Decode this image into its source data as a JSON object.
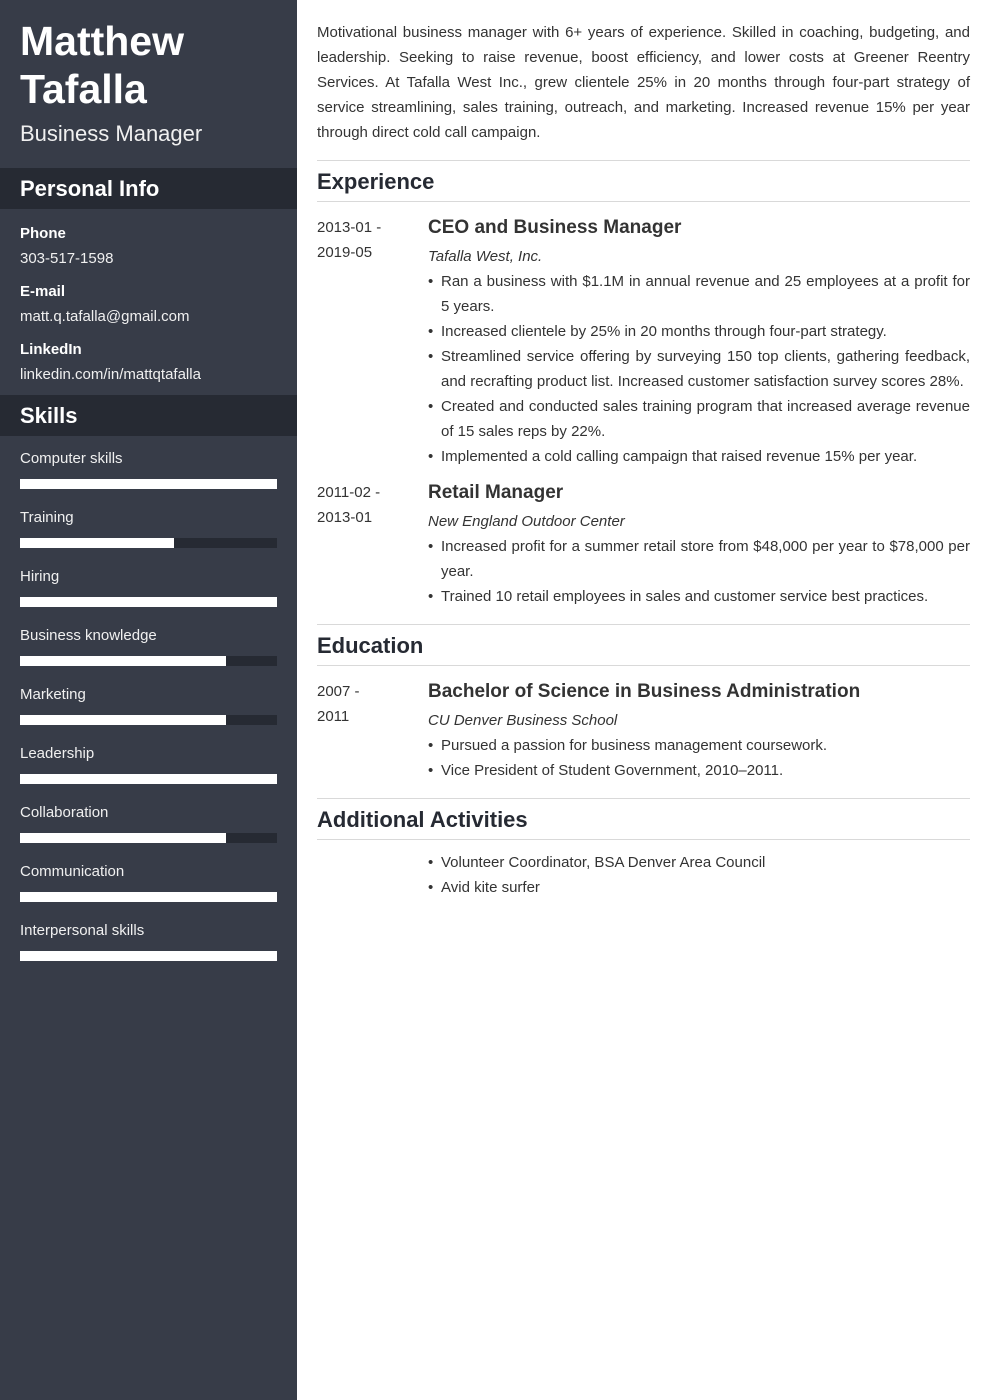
{
  "profile": {
    "first_name": "Matthew",
    "last_name": "Tafalla",
    "role": "Business Manager"
  },
  "personal_info": {
    "title": "Personal Info",
    "items": [
      {
        "label": "Phone",
        "value": "303-517-1598"
      },
      {
        "label": "E-mail",
        "value": "matt.q.tafalla@gmail.com"
      },
      {
        "label": "LinkedIn",
        "value": "linkedin.com/in/mattqtafalla"
      }
    ]
  },
  "skills": {
    "title": "Skills",
    "items": [
      {
        "label": "Computer skills",
        "level": 1.0
      },
      {
        "label": "Training",
        "level": 0.6
      },
      {
        "label": "Hiring",
        "level": 1.0
      },
      {
        "label": "Business knowledge",
        "level": 0.8
      },
      {
        "label": "Marketing",
        "level": 0.8
      },
      {
        "label": "Leadership",
        "level": 1.0
      },
      {
        "label": "Collaboration",
        "level": 0.8
      },
      {
        "label": "Communication",
        "level": 1.0
      },
      {
        "label": "Interpersonal skills",
        "level": 1.0
      }
    ]
  },
  "summary": "Motivational business manager with 6+ years of experience. Skilled in coaching, budgeting, and leadership. Seeking to raise revenue, boost efficiency, and lower costs at Greener Reentry Services. At Tafalla West Inc., grew clientele 25% in 20 months through four-part strategy of service streamlining, sales training, outreach, and marketing. Increased revenue 15% per year through direct cold call campaign.",
  "experience": {
    "title": "Experience",
    "entries": [
      {
        "date_start": "2013-01 -",
        "date_end": "2019-05",
        "title": "CEO and Business Manager",
        "org": "Tafalla West, Inc.",
        "bullets": [
          "Ran a business with $1.1M in annual revenue and 25 employees at a profit for 5 years.",
          "Increased clientele by 25% in 20 months through four-part strategy.",
          "Streamlined service offering by surveying 150 top clients, gathering feedback, and recrafting product list. Increased customer satisfaction survey scores 28%.",
          "Created and conducted sales training program that increased average revenue of 15 sales reps by 22%.",
          "Implemented a cold calling campaign that raised revenue 15% per year."
        ]
      },
      {
        "date_start": "2011-02 -",
        "date_end": "2013-01",
        "title": "Retail Manager",
        "org": "New England Outdoor Center",
        "bullets": [
          "Increased profit for a summer retail store from $48,000 per year to $78,000 per year.",
          "Trained 10 retail employees in sales and customer service best practices."
        ]
      }
    ]
  },
  "education": {
    "title": "Education",
    "entries": [
      {
        "date_start": "2007 -",
        "date_end": "2011",
        "title": "Bachelor of Science in Business Administration",
        "org": "CU Denver Business School",
        "bullets": [
          "Pursued a passion for business management coursework.",
          "Vice President of Student Government, 2010–2011."
        ]
      }
    ]
  },
  "activities": {
    "title": "Additional Activities",
    "items": [
      "Volunteer Coordinator, BSA Denver Area Council",
      "Avid kite surfer"
    ]
  }
}
